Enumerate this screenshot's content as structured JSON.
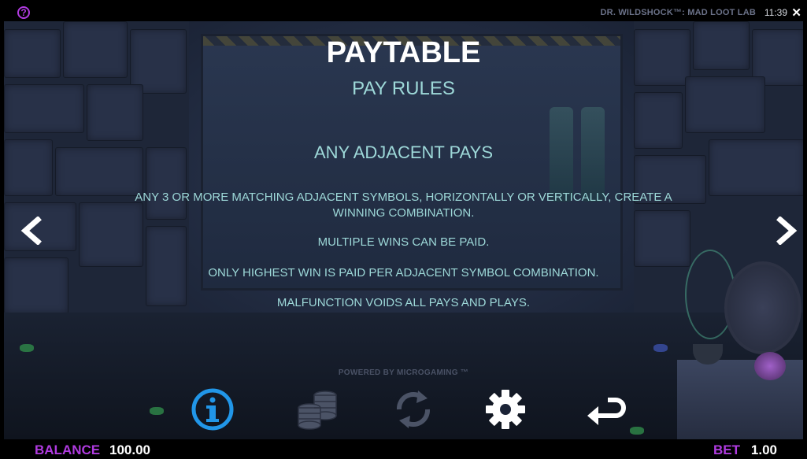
{
  "header": {
    "help_symbol": "?",
    "game_title": "DR. WILDSHOCK™: MAD LOOT LAB",
    "time": "11:39",
    "close_symbol": "✕"
  },
  "paytable": {
    "title": "PAYTABLE",
    "subtitle": "PAY RULES",
    "section_title": "ANY ADJACENT PAYS",
    "rules": [
      "ANY 3 OR MORE MATCHING ADJACENT SYMBOLS, HORIZONTALLY OR VERTICALLY, CREATE A WINNING COMBINATION.",
      "MULTIPLE WINS CAN BE PAID.",
      "ONLY HIGHEST WIN IS PAID PER ADJACENT SYMBOL COMBINATION.",
      "MALFUNCTION VOIDS ALL PAYS AND PLAYS."
    ]
  },
  "navigation": {
    "prev_icon": "chevron-left-icon",
    "next_icon": "chevron-right-icon"
  },
  "footer": {
    "powered_by": "POWERED BY MICROGAMING ™",
    "toolbar_icons": [
      "info-icon",
      "coins-icon",
      "autoplay-icon",
      "gear-icon",
      "back-icon"
    ],
    "balance_label": "BALANCE",
    "balance_value": "100.00",
    "bet_label": "BET",
    "bet_value": "1.00"
  },
  "colors": {
    "accent_purple": "#b03be0",
    "rules_text": "#9dd8d8",
    "info_blue": "#2196e8",
    "disabled_icon": "#4b5366"
  }
}
